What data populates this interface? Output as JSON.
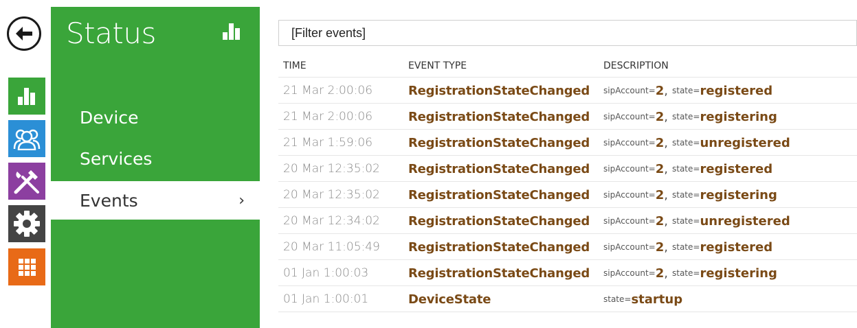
{
  "nav": {
    "back": {
      "icon": "arrow-left-icon"
    },
    "rail": [
      {
        "name": "status",
        "icon": "bar-chart-icon",
        "color": "#3aa53a"
      },
      {
        "name": "directory",
        "icon": "users-icon",
        "color": "#2b8fd6"
      },
      {
        "name": "hardware",
        "icon": "tools-icon",
        "color": "#8c3fa0"
      },
      {
        "name": "services",
        "icon": "gear-icon",
        "color": "#444444"
      },
      {
        "name": "system",
        "icon": "grid-icon",
        "color": "#e86a17"
      }
    ]
  },
  "sidebar": {
    "title": "Status",
    "title_icon": "bar-chart-icon",
    "items": [
      {
        "label": "Device"
      },
      {
        "label": "Services"
      },
      {
        "label": "Events",
        "active": true
      }
    ],
    "active_chevron": "›"
  },
  "filter": {
    "placeholder": "[Filter events]",
    "value": ""
  },
  "table": {
    "headers": {
      "time": "TIME",
      "event_type": "EVENT TYPE",
      "description": "DESCRIPTION"
    },
    "rows": [
      {
        "time": "21 Mar 2:00:06",
        "type": "RegistrationStateChanged",
        "params": [
          {
            "key": "sipAccount",
            "value": "2"
          },
          {
            "key": "state",
            "value": "registered"
          }
        ]
      },
      {
        "time": "21 Mar 2:00:06",
        "type": "RegistrationStateChanged",
        "params": [
          {
            "key": "sipAccount",
            "value": "2"
          },
          {
            "key": "state",
            "value": "registering"
          }
        ]
      },
      {
        "time": "21 Mar 1:59:06",
        "type": "RegistrationStateChanged",
        "params": [
          {
            "key": "sipAccount",
            "value": "2"
          },
          {
            "key": "state",
            "value": "unregistered"
          }
        ]
      },
      {
        "time": "20 Mar 12:35:02",
        "type": "RegistrationStateChanged",
        "params": [
          {
            "key": "sipAccount",
            "value": "2"
          },
          {
            "key": "state",
            "value": "registered"
          }
        ]
      },
      {
        "time": "20 Mar 12:35:02",
        "type": "RegistrationStateChanged",
        "params": [
          {
            "key": "sipAccount",
            "value": "2"
          },
          {
            "key": "state",
            "value": "registering"
          }
        ]
      },
      {
        "time": "20 Mar 12:34:02",
        "type": "RegistrationStateChanged",
        "params": [
          {
            "key": "sipAccount",
            "value": "2"
          },
          {
            "key": "state",
            "value": "unregistered"
          }
        ]
      },
      {
        "time": "20 Mar 11:05:49",
        "type": "RegistrationStateChanged",
        "params": [
          {
            "key": "sipAccount",
            "value": "2"
          },
          {
            "key": "state",
            "value": "registered"
          }
        ]
      },
      {
        "time": "01 Jan 1:00:03",
        "type": "RegistrationStateChanged",
        "params": [
          {
            "key": "sipAccount",
            "value": "2"
          },
          {
            "key": "state",
            "value": "registering"
          }
        ]
      },
      {
        "time": "01 Jan 1:00:01",
        "type": "DeviceState",
        "params": [
          {
            "key": "state",
            "value": "startup"
          }
        ]
      }
    ]
  },
  "colors": {
    "panel_green": "#3aa53a",
    "event_brown": "#7a4a16",
    "time_gray": "#8a8a8a"
  }
}
